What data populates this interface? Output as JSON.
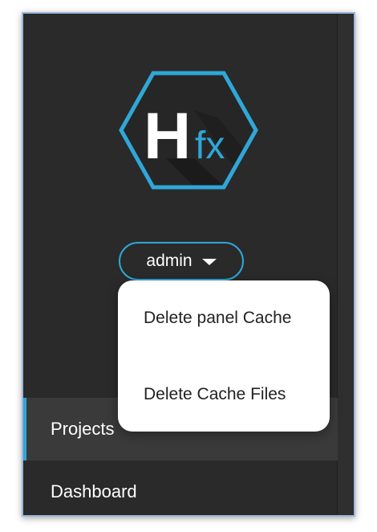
{
  "logo": {
    "letter": "H",
    "suffix": "fx",
    "icon": "hfx-hexagon-logo-icon",
    "accent_color": "#2fa7d8"
  },
  "user_menu": {
    "username": "admin",
    "caret_icon": "caret-down-icon"
  },
  "dropdown": {
    "items": [
      {
        "label": "Delete panel Cache"
      },
      {
        "label": "Delete Cache Files"
      }
    ]
  },
  "sidebar": {
    "items": [
      {
        "label": "Projects",
        "active": true
      },
      {
        "label": "Dashboard",
        "active": false
      }
    ]
  },
  "colors": {
    "background": "#2a2a2a",
    "accent": "#2fa7d8",
    "frame_border": "#9db6dc",
    "active_item": "#3a3a3a"
  }
}
